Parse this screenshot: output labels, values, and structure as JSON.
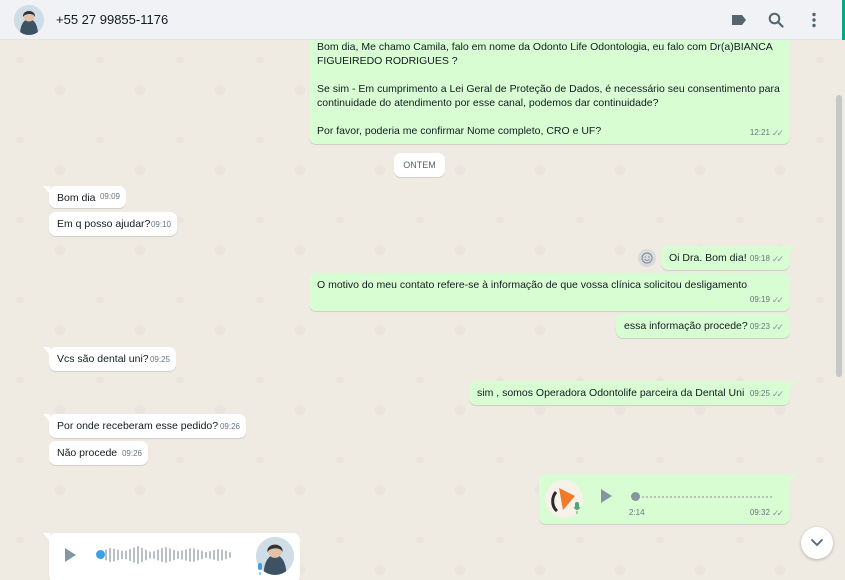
{
  "header": {
    "contact_name": "+55 27 99855-1176",
    "icons": [
      "label-icon",
      "search-icon",
      "menu-icon"
    ]
  },
  "day_divider": "ONTEM",
  "messages": [
    {
      "dir": "out",
      "text": "Bom dia, Me chamo Camila, falo em nome da Odonto Life Odontologia, eu falo com Dr(a)BIANCA FIGUEIREDO RODRIGUES ?\n\nSe sim - Em cumprimento a Lei Geral de Proteção de Dados, é necessário seu consentimento para continuidade do atendimento por esse canal, podemos dar continuidade?\n\nPor favor, poderia me confirmar Nome completo, CRO e UF?",
      "time": "12:21"
    },
    {
      "dir": "in",
      "text": "Bom dia",
      "time": "09:09"
    },
    {
      "dir": "in",
      "text": "Em q posso ajudar?",
      "time": "09:10"
    },
    {
      "dir": "out",
      "text": "Oi Dra. Bom dia!",
      "time": "09:18"
    },
    {
      "dir": "out",
      "text": "O motivo do meu contato refere-se à informação de que vossa clínica solicitou desligamento",
      "time": "09:19"
    },
    {
      "dir": "out",
      "text": "essa informação procede?",
      "time": "09:23"
    },
    {
      "dir": "in",
      "text": "Vcs são dental uni?",
      "time": "09:25"
    },
    {
      "dir": "out",
      "text": "sim , somos Operadora Odontolife parceira da Dental Uni",
      "time": "09:25"
    },
    {
      "dir": "in",
      "text": "Por onde receberam esse pedido?",
      "time": "09:26"
    },
    {
      "dir": "in",
      "text": "Não procede",
      "time": "09:26"
    }
  ],
  "voice_out": {
    "duration": "2:14",
    "time": "09:32"
  },
  "colors": {
    "outgoing": "#d9fdd3",
    "incoming": "#ffffff",
    "accent": "#00a884",
    "background": "#efeae2"
  }
}
